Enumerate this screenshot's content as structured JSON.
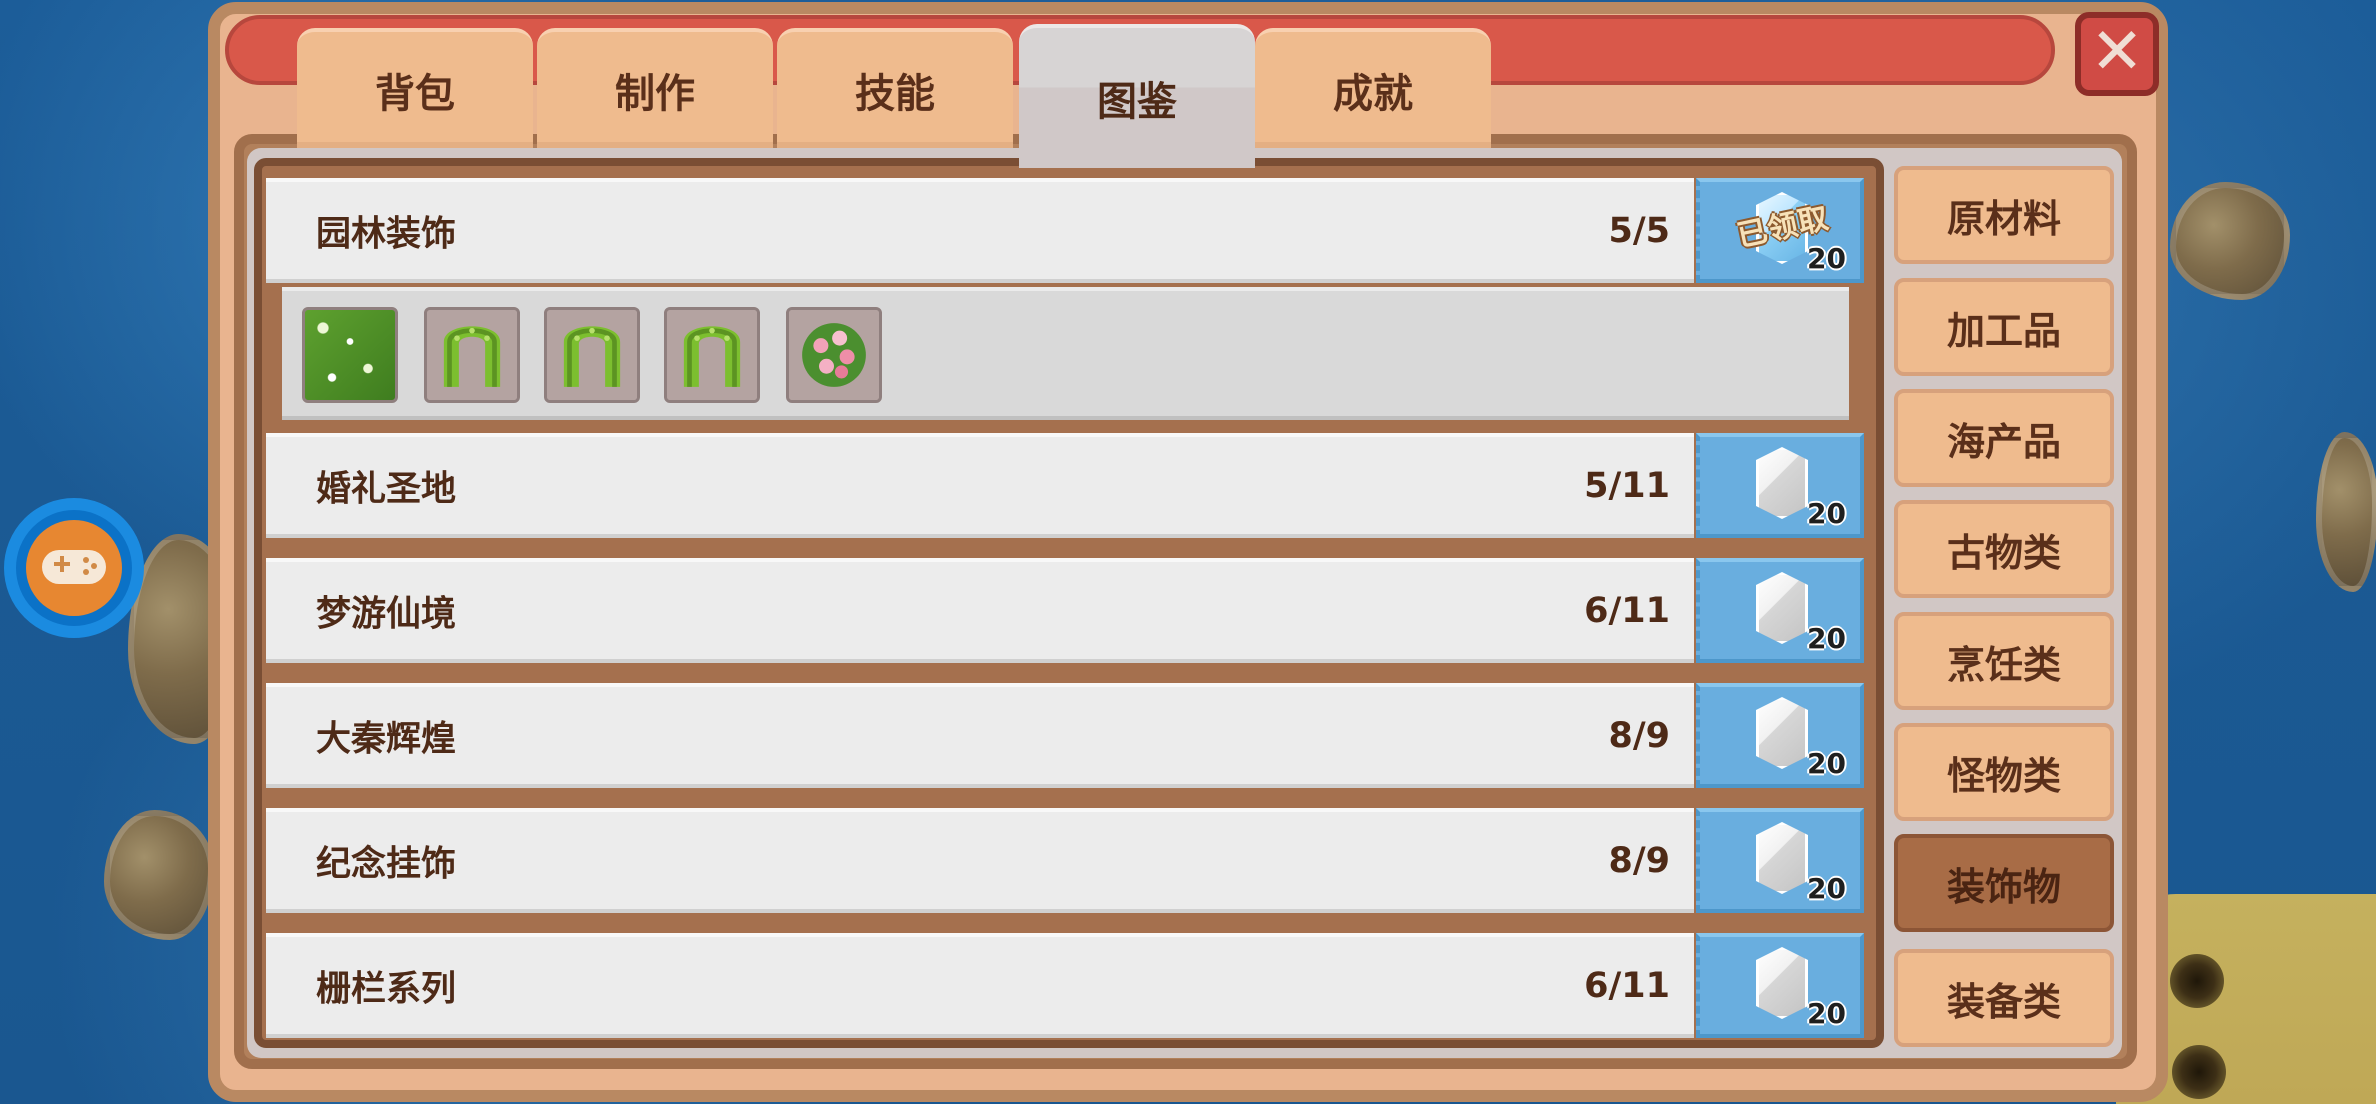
{
  "tabs": [
    {
      "label": "背包",
      "active": false
    },
    {
      "label": "制作",
      "active": false
    },
    {
      "label": "技能",
      "active": false
    },
    {
      "label": "图鉴",
      "active": true
    },
    {
      "label": "成就",
      "active": false
    }
  ],
  "collections": [
    {
      "name": "园林装饰",
      "progress": "5/5",
      "reward_amount": "20",
      "reward_claimed": true,
      "reward_claimed_text": "已领取",
      "items": [
        {
          "icon": "hedge-bush-icon"
        },
        {
          "icon": "hedge-arch-icon"
        },
        {
          "icon": "hedge-arch-icon"
        },
        {
          "icon": "hedge-arch-icon"
        },
        {
          "icon": "flower-bush-icon"
        }
      ]
    },
    {
      "name": "婚礼圣地",
      "progress": "5/11",
      "reward_amount": "20",
      "reward_claimed": false
    },
    {
      "name": "梦游仙境",
      "progress": "6/11",
      "reward_amount": "20",
      "reward_claimed": false
    },
    {
      "name": "大秦辉煌",
      "progress": "8/9",
      "reward_amount": "20",
      "reward_claimed": false
    },
    {
      "name": "纪念挂饰",
      "progress": "8/9",
      "reward_amount": "20",
      "reward_claimed": false
    },
    {
      "name": "栅栏系列",
      "progress": "6/11",
      "reward_amount": "20",
      "reward_claimed": false
    }
  ],
  "sidebar": [
    {
      "label": "原材料",
      "active": false
    },
    {
      "label": "加工品",
      "active": false
    },
    {
      "label": "海产品",
      "active": false
    },
    {
      "label": "古物类",
      "active": false
    },
    {
      "label": "烹饪类",
      "active": false
    },
    {
      "label": "怪物类",
      "active": false
    },
    {
      "label": "装饰物",
      "active": true
    },
    {
      "label": "装备类",
      "active": false
    }
  ],
  "close_icon": "close-icon",
  "gamepad_icon": "gamepad-icon",
  "colors": {
    "title_bar": "#d9584a",
    "panel_brown": "#a5704e",
    "reward_blue": "#69aedf",
    "sidebar_active": "#a86c46"
  }
}
